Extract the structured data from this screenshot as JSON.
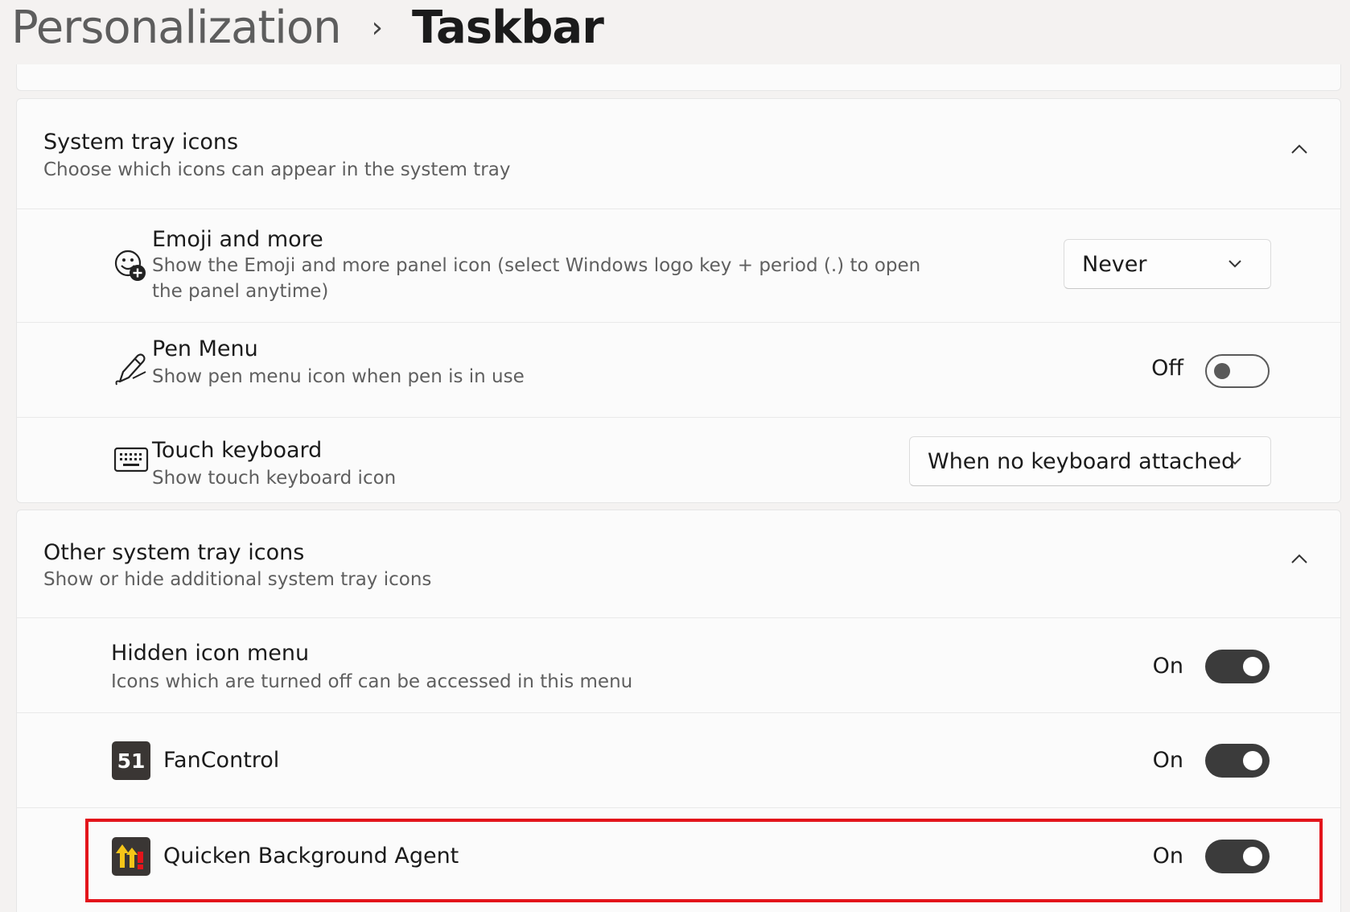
{
  "header": {
    "breadcrumb_parent": "Personalization",
    "breadcrumb_separator": "›",
    "breadcrumb_current": "Taskbar"
  },
  "system_tray": {
    "title": "System tray icons",
    "description": "Choose which icons can appear in the system tray",
    "items": [
      {
        "title": "Emoji and more",
        "description": "Show the Emoji and more panel icon (select Windows logo key + period (.) to open the panel anytime)",
        "control": "dropdown",
        "value": "Never",
        "icon": "emoji-icon"
      },
      {
        "title": "Pen Menu",
        "description": "Show pen menu icon when pen is in use",
        "control": "toggle",
        "state_label": "Off",
        "on": false,
        "icon": "pen-icon"
      },
      {
        "title": "Touch keyboard",
        "description": "Show touch keyboard icon",
        "control": "dropdown",
        "value": "When no keyboard attached",
        "icon": "keyboard-icon"
      }
    ]
  },
  "other_tray": {
    "title": "Other system tray icons",
    "description": "Show or hide additional system tray icons",
    "items": [
      {
        "title": "Hidden icon menu",
        "description": "Icons which are turned off can be accessed in this menu",
        "control": "toggle",
        "state_label": "On",
        "on": true
      },
      {
        "title": "FanControl",
        "control": "toggle",
        "state_label": "On",
        "on": true,
        "icon": "fancontrol-app-icon",
        "icon_text": "51"
      },
      {
        "title": "Quicken Background Agent",
        "control": "toggle",
        "state_label": "On",
        "on": true,
        "icon": "quicken-app-icon",
        "highlighted": true
      }
    ]
  },
  "colors": {
    "toggle_on": "#3b3b3b",
    "highlight": "#e3141b",
    "page_bg": "#f4f2f1",
    "card_bg": "#fbfbfb"
  }
}
